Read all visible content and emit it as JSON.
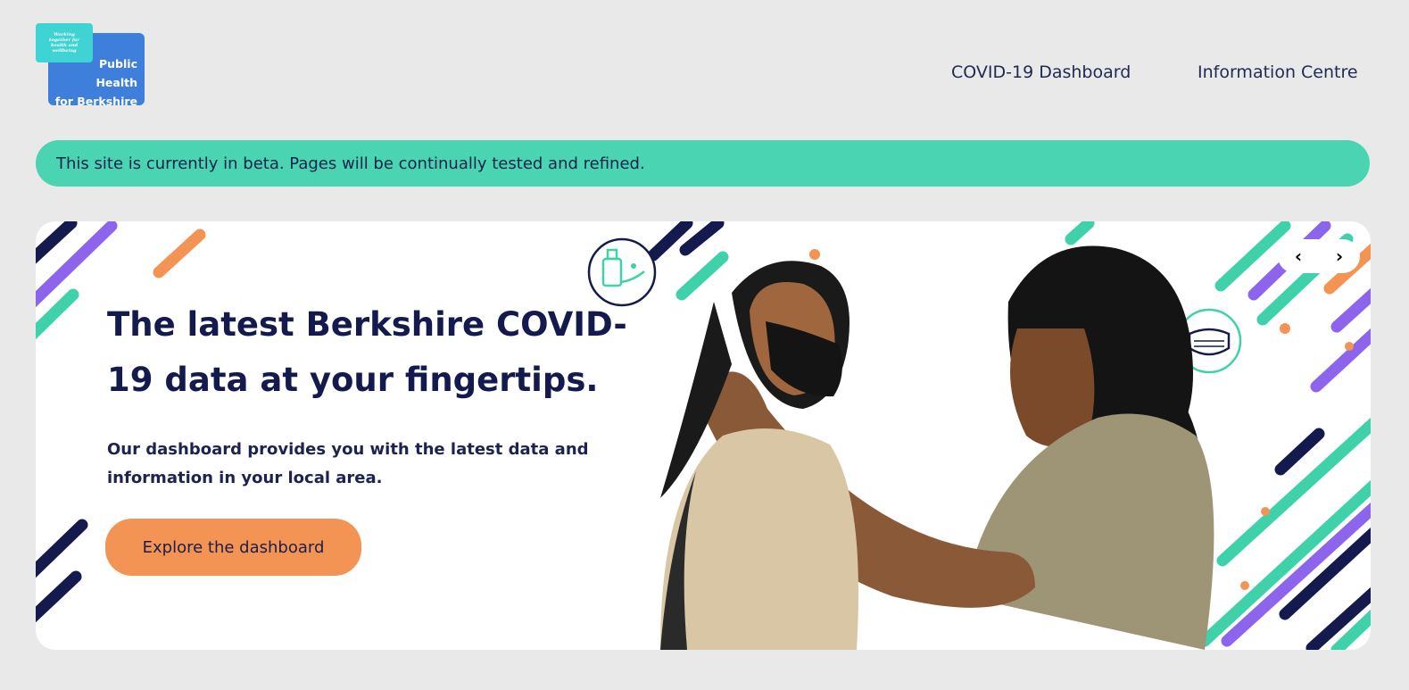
{
  "logo": {
    "tagline": "Working\ntogether for\nhealth and\nwellbeing",
    "name": "Public\nHealth\nfor Berkshire"
  },
  "nav": {
    "items": [
      {
        "label": "COVID-19 Dashboard"
      },
      {
        "label": "Information Centre"
      }
    ]
  },
  "banner": {
    "text": "This site is currently in beta. Pages will be continually tested and refined."
  },
  "hero": {
    "title": "The latest Berkshire COVID-19 data at your fingertips.",
    "text": "Our dashboard provides you with the latest data and information in your local area.",
    "button_label": "Explore the dashboard",
    "prev_label": "‹",
    "next_label": "›"
  },
  "colors": {
    "page_bg": "#e9e9e9",
    "banner_bg": "#4ad4b2",
    "button_bg": "#f39354",
    "navy": "#141a4d",
    "purple": "#8d64ec",
    "teal": "#3fd1a9",
    "orange": "#f39354",
    "logo_blue": "#3f7fdc",
    "logo_cyan": "#3fd3d3"
  },
  "icons": [
    "hand-sanitizer-icon",
    "face-mask-icon",
    "chevron-left-icon",
    "chevron-right-icon"
  ]
}
